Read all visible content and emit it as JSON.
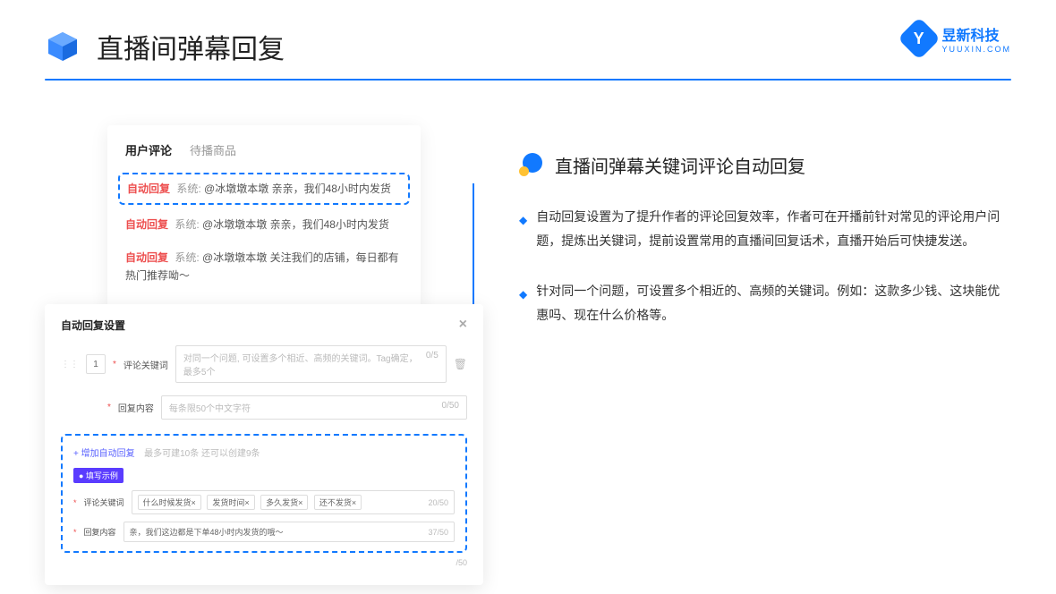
{
  "header": {
    "title": "直播间弹幕回复",
    "brand_name": "昱新科技",
    "brand_sub": "YUUXIN.COM",
    "brand_letter": "Y"
  },
  "comments_card": {
    "tab_active": "用户评论",
    "tab_inactive": "待播商品",
    "rows": [
      {
        "badge": "自动回复",
        "sys": "系统:",
        "text": "@冰墩墩本墩 亲亲，我们48小时内发货",
        "highlight": true
      },
      {
        "badge": "自动回复",
        "sys": "系统:",
        "text": "@冰墩墩本墩 亲亲，我们48小时内发货",
        "highlight": false
      },
      {
        "badge": "自动回复",
        "sys": "系统:",
        "text": "@冰墩墩本墩 关注我们的店铺，每日都有热门推荐呦～",
        "highlight": false
      }
    ]
  },
  "settings_card": {
    "title": "自动回复设置",
    "num": "1",
    "label_keyword": "评论关键词",
    "placeholder_keyword": "对同一个问题, 可设置多个相近、高频的关键词。Tag确定，最多5个",
    "count_keyword": "0/5",
    "label_content": "回复内容",
    "placeholder_content": "每条限50个中文字符",
    "count_content": "0/50",
    "add_link": "+ 增加自动回复",
    "add_hint": "最多可建10条 还可以创建9条",
    "pill": "● 填写示例",
    "ex_label_keyword": "评论关键词",
    "ex_tags": [
      "什么时候发货×",
      "发货时间×",
      "多久发货×",
      "还不发货×"
    ],
    "ex_keyword_count": "20/50",
    "ex_label_content": "回复内容",
    "ex_content_value": "亲，我们这边都是下单48小时内发货的哦～",
    "ex_content_count": "37/50",
    "outer_count": "/50"
  },
  "right": {
    "section_title": "直播间弹幕关键词评论自动回复",
    "bullets": [
      "自动回复设置为了提升作者的评论回复效率，作者可在开播前针对常见的评论用户问题，提炼出关键词，提前设置常用的直播间回复话术，直播开始后可快捷发送。",
      "针对同一个问题，可设置多个相近的、高频的关键词。例如：这款多少钱、这块能优惠吗、现在什么价格等。"
    ]
  }
}
